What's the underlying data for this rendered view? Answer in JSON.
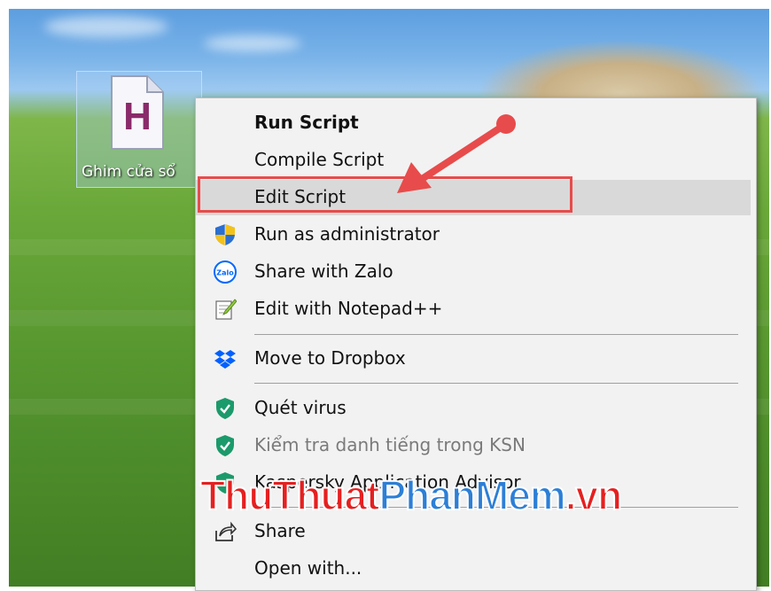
{
  "desktop_icon": {
    "glyph": "H",
    "label": "Ghim cửa sổ"
  },
  "menu": {
    "items": [
      {
        "label": "Run Script",
        "icon": "none",
        "style": "bold"
      },
      {
        "label": "Compile Script",
        "icon": "none"
      },
      {
        "label": "Edit Script",
        "icon": "none",
        "state": "hover"
      },
      {
        "label": "Run as administrator",
        "icon": "uac-shield-icon"
      },
      {
        "label": "Share with Zalo",
        "icon": "zalo-icon",
        "icon_text": "Zalo"
      },
      {
        "label": "Edit with Notepad++",
        "icon": "notepad-plus-plus-icon"
      },
      {
        "label": "Move to Dropbox",
        "icon": "dropbox-icon"
      },
      {
        "label": "Quét virus",
        "icon": "kaspersky-shield-icon"
      },
      {
        "label": "Kiểm tra danh tiếng trong KSN",
        "icon": "kaspersky-shield-icon",
        "state": "disabled"
      },
      {
        "label": "Kaspersky Application Advisor",
        "icon": "kaspersky-shield-icon"
      },
      {
        "label": "Share",
        "icon": "share-icon"
      },
      {
        "label": "Open with...",
        "icon": "none"
      }
    ]
  },
  "watermark": {
    "part1": "ThuThuat",
    "part2": "PhanMem",
    "part3": ".vn"
  },
  "colors": {
    "annotation_red": "#e84b4b",
    "menu_bg": "#f2f2f2",
    "hover_bg": "#d9d9d9",
    "kaspersky_green": "#1b9a6b",
    "dropbox_blue": "#0061fe",
    "zalo_blue": "#0068ff"
  }
}
